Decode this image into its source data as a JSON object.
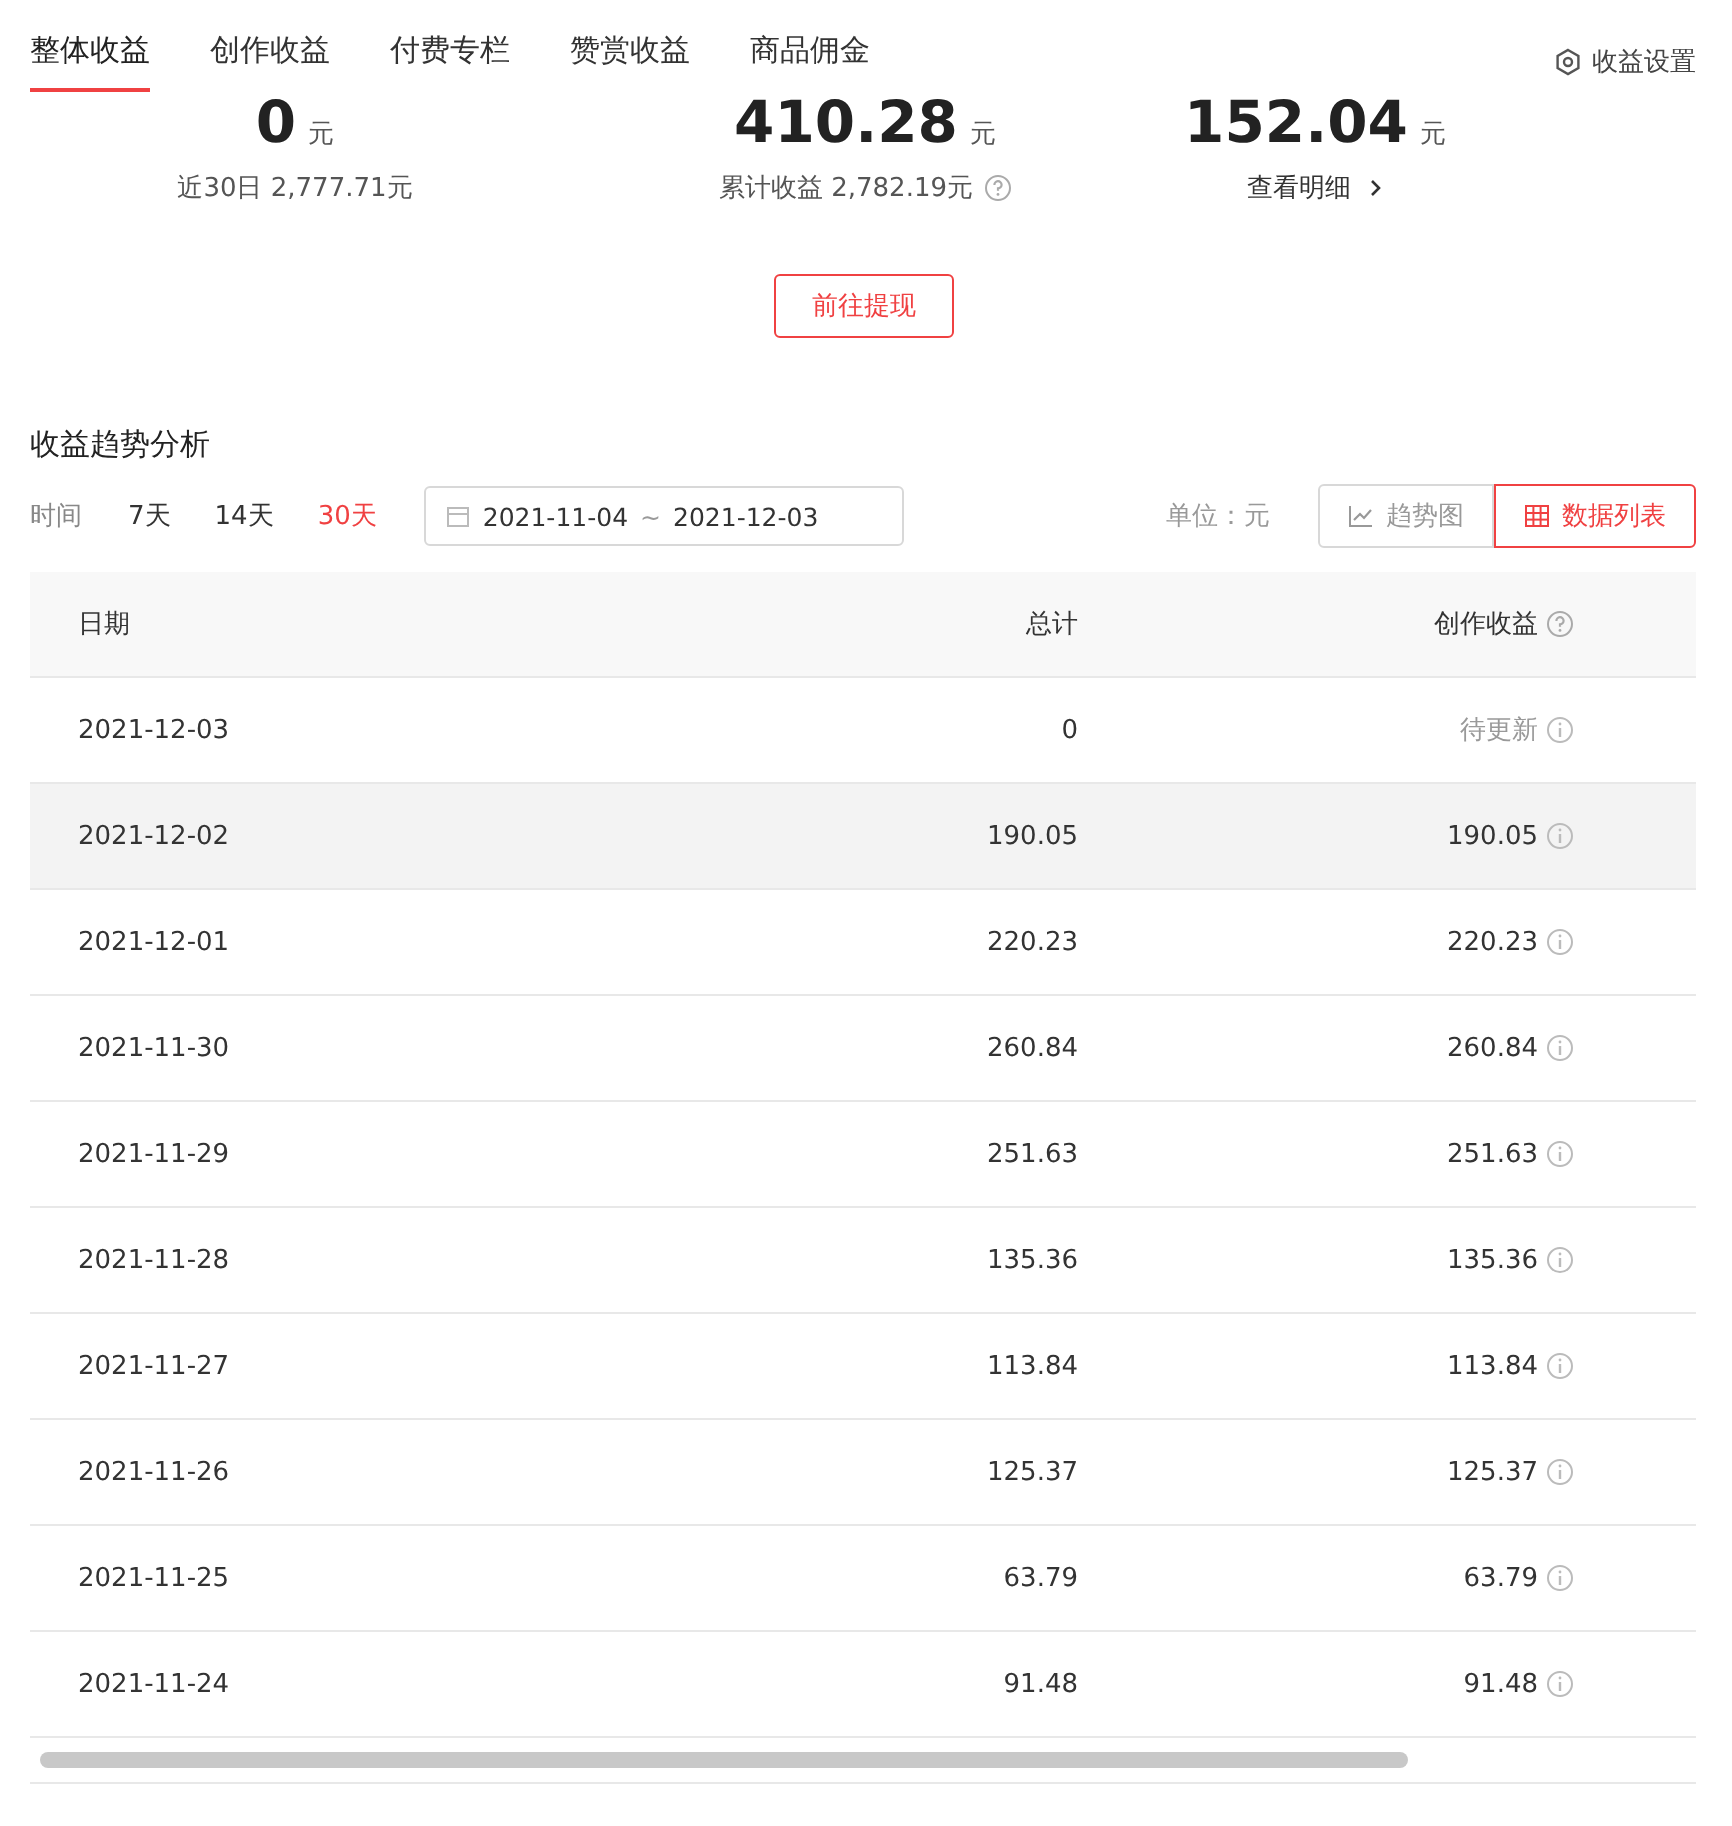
{
  "tabs": [
    {
      "label": "整体收益",
      "selected": true
    },
    {
      "label": "创作收益",
      "selected": false
    },
    {
      "label": "付费专栏",
      "selected": false
    },
    {
      "label": "赞赏收益",
      "selected": false
    },
    {
      "label": "商品佣金",
      "selected": false
    }
  ],
  "settings_link": "收益设置",
  "stats": [
    {
      "value": "0",
      "unit": "元",
      "note": "近30日 2,777.71元",
      "kind": "plain"
    },
    {
      "value": "410.28",
      "unit": "元",
      "note": "累计收益 2,782.19元",
      "kind": "help"
    },
    {
      "value": "152.04",
      "unit": "元",
      "note": "查看明细",
      "kind": "link"
    }
  ],
  "withdraw_button": "前往提现",
  "section_title": "收益趋势分析",
  "filter": {
    "label": "时间",
    "ranges": [
      {
        "label": "7天",
        "selected": false
      },
      {
        "label": "14天",
        "selected": false
      },
      {
        "label": "30天",
        "selected": true
      }
    ],
    "date_start": "2021-11-04",
    "date_sep": "~",
    "date_end": "2021-12-03",
    "unit_label": "单位：元",
    "views": [
      {
        "label": "趋势图",
        "kind": "chart",
        "selected": false
      },
      {
        "label": "数据列表",
        "kind": "table",
        "selected": true
      }
    ]
  },
  "table": {
    "columns": [
      "日期",
      "总计",
      "创作收益"
    ],
    "rows": [
      {
        "date": "2021-12-03",
        "total": "0",
        "creation": "待更新",
        "pending": true,
        "selected": false
      },
      {
        "date": "2021-12-02",
        "total": "190.05",
        "creation": "190.05",
        "pending": false,
        "selected": true
      },
      {
        "date": "2021-12-01",
        "total": "220.23",
        "creation": "220.23",
        "pending": false,
        "selected": false
      },
      {
        "date": "2021-11-30",
        "total": "260.84",
        "creation": "260.84",
        "pending": false,
        "selected": false
      },
      {
        "date": "2021-11-29",
        "total": "251.63",
        "creation": "251.63",
        "pending": false,
        "selected": false
      },
      {
        "date": "2021-11-28",
        "total": "135.36",
        "creation": "135.36",
        "pending": false,
        "selected": false
      },
      {
        "date": "2021-11-27",
        "total": "113.84",
        "creation": "113.84",
        "pending": false,
        "selected": false
      },
      {
        "date": "2021-11-26",
        "total": "125.37",
        "creation": "125.37",
        "pending": false,
        "selected": false
      },
      {
        "date": "2021-11-25",
        "total": "63.79",
        "creation": "63.79",
        "pending": false,
        "selected": false
      },
      {
        "date": "2021-11-24",
        "total": "91.48",
        "creation": "91.48",
        "pending": false,
        "selected": false
      }
    ]
  }
}
